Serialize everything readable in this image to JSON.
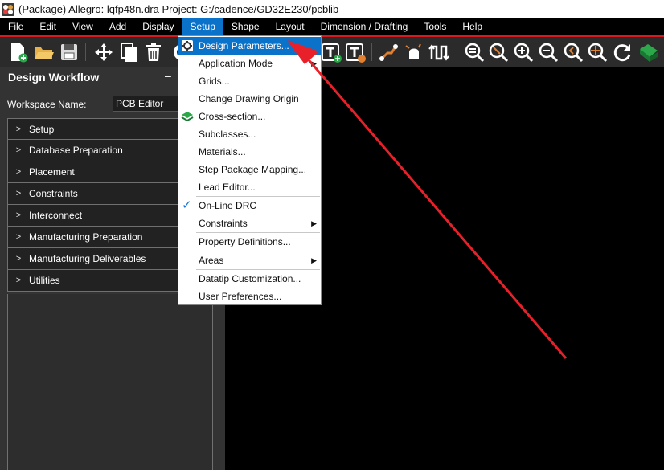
{
  "window": {
    "title": "(Package) Allegro: lqfp48n.dra  Project: G:/cadence/GD32E230/pcblib"
  },
  "menubar": {
    "items": [
      "File",
      "Edit",
      "View",
      "Add",
      "Display",
      "Setup",
      "Shape",
      "Layout",
      "Dimension / Drafting",
      "Tools",
      "Help"
    ],
    "active": "Setup"
  },
  "toolbar": {
    "icons": [
      "new-file-icon",
      "open-folder-icon",
      "save-icon",
      "move-icon",
      "copy-icon",
      "delete-icon",
      "text-icon",
      "text-edit-icon",
      "add-connect-icon",
      "slide-icon",
      "delay-tune-icon",
      "zoom-fit-icon",
      "zoom-window-icon",
      "zoom-in-icon",
      "zoom-out-icon",
      "zoom-previous-icon",
      "zoom-center-icon",
      "redraw-icon",
      "board-3d-icon"
    ]
  },
  "workflow": {
    "title": "Design Workflow",
    "close_glyph": "–",
    "workspace_label": "Workspace Name:",
    "workspace_value": "PCB Editor",
    "items": [
      "Setup",
      "Database Preparation",
      "Placement",
      "Constraints",
      "Interconnect",
      "Manufacturing Preparation",
      "Manufacturing Deliverables",
      "Utilities"
    ]
  },
  "setup_menu": {
    "items": [
      {
        "label": "Design Parameters...",
        "highlighted": true
      },
      {
        "label": "Application Mode",
        "submenu": true
      },
      {
        "label": "Grids..."
      },
      {
        "label": "Change Drawing Origin"
      },
      {
        "label": "Cross-section..."
      },
      {
        "label": "Subclasses..."
      },
      {
        "label": "Materials..."
      },
      {
        "label": "Step Package Mapping..."
      },
      {
        "label": "Lead Editor..."
      },
      {
        "label": "On-Line DRC",
        "checked": true
      },
      {
        "label": "Constraints",
        "submenu": true
      },
      {
        "label": "Property Definitions..."
      },
      {
        "label": "Areas",
        "submenu": true
      },
      {
        "label": "Datatip Customization..."
      },
      {
        "label": "User Preferences..."
      }
    ]
  },
  "colors": {
    "accent": "#0b72c9",
    "annotation_arrow": "#e8202a",
    "canvas": "#000000",
    "check": "#1a73d9"
  }
}
